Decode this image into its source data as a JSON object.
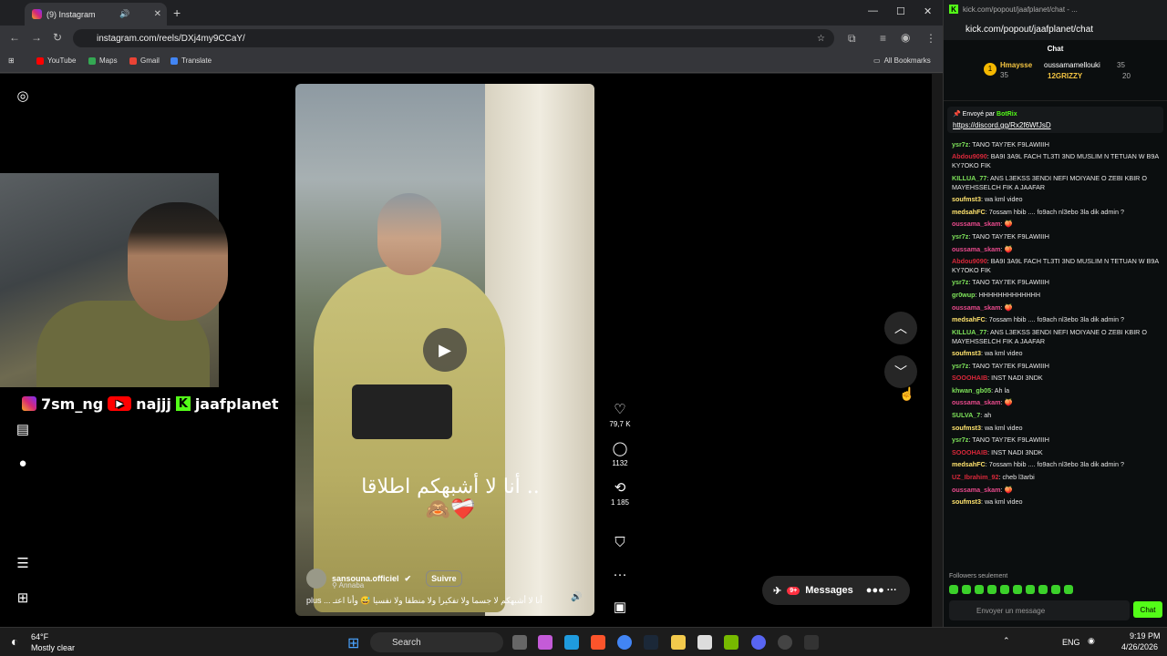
{
  "browser": {
    "tab_title": "(9) Instagram",
    "url": "instagram.com/reels/DXj4my9CCaY/",
    "bookmarks": [
      "YouTube",
      "Maps",
      "Gmail",
      "Translate"
    ],
    "all_bookmarks": "All Bookmarks"
  },
  "reel": {
    "username": "sansouna.officiel",
    "follow": "Suivre",
    "location": "Annaba",
    "overlay_text": "أنا لا أشبهكم اطلاقا ..🙈❤️‍🩹",
    "caption": "أنا لا أشبهكم لا جسما ولا تفكيرا ولا منطقا ولا نفسيا 😅 وأنا اعتـ",
    "more": "plus ...",
    "likes": "79,7 K",
    "comments": "1132",
    "shares": "1 185",
    "messages_label": "Messages",
    "messages_badge": "9+"
  },
  "stream_overlay": {
    "handle1": "7sm_ng",
    "handle2": "najjj",
    "handle3": "jaafplanet"
  },
  "chat": {
    "window_title": "kick.com/popout/jaafplanet/chat - ...",
    "url": "kick.com/popout/jaafplanet/chat",
    "header": "Chat",
    "gifters": [
      {
        "rank": "1",
        "name": "Hmaysse",
        "count": "35"
      },
      {
        "name": "oussamamellouki",
        "count": "35"
      },
      {
        "name": "12GRIZZY",
        "count": "20"
      }
    ],
    "pinned_by": "Envoyé par",
    "pinned_user": "BotRix",
    "pinned_link": "https://discord.gg/Rx2f6WfJsD",
    "messages": [
      {
        "user": "ysr7z",
        "color": "#7ee35a",
        "text": "TANO TAY7EK F9LAWIIIH"
      },
      {
        "user": "Abdou9090",
        "color": "#d9283a",
        "text": "BA9I 3A9L FACH TL3TI 3ND MUSLIM N TETUAN W B9A KY7OKO FIK"
      },
      {
        "user": "KILLUA_77",
        "color": "#7ee35a",
        "text": "ANS L3EKSS 3ENDI NEFI MOIYANE O ZEBI KBIR O MAYEHSSELCH FIK A JAAFAR"
      },
      {
        "user": "soufmst3",
        "color": "#ffe36e",
        "text": "wa kml video"
      },
      {
        "user": "medsahFC",
        "color": "#ffe36e",
        "text": "7ossam hbib .... fo9ach nl3ebo 3la dik admin ?"
      },
      {
        "user": "oussama_skam",
        "color": "#e84a8c",
        "text": "🍑"
      },
      {
        "user": "ysr7z",
        "color": "#7ee35a",
        "text": "TANO TAY7EK F9LAWIIIH"
      },
      {
        "user": "oussama_skam",
        "color": "#e84a8c",
        "text": "🍑"
      },
      {
        "user": "Abdou9090",
        "color": "#d9283a",
        "text": "BA9I 3A9L FACH TL3TI 3ND MUSLIM N TETUAN W B9A KY7OKO FIK"
      },
      {
        "user": "ysr7z",
        "color": "#7ee35a",
        "text": "TANO TAY7EK F9LAWIIIH"
      },
      {
        "user": "gr0wup",
        "color": "#7ee35a",
        "text": "HHHHHHHHHHHHH"
      },
      {
        "user": "oussama_skam",
        "color": "#e84a8c",
        "text": "🍑"
      },
      {
        "user": "medsahFC",
        "color": "#ffe36e",
        "text": "7ossam hbib .... fo9ach nl3ebo 3la dik admin ?"
      },
      {
        "user": "KILLUA_77",
        "color": "#7ee35a",
        "text": "ANS L3EKSS 3ENDI NEFI MOIYANE O ZEBI KBIR O MAYEHSSELCH FIK A JAAFAR"
      },
      {
        "user": "soufmst3",
        "color": "#ffe36e",
        "text": "wa kml video"
      },
      {
        "user": "ysr7z",
        "color": "#7ee35a",
        "text": "TANO TAY7EK F9LAWIIIH"
      },
      {
        "user": "SOOOHAIB",
        "color": "#d9283a",
        "text": "INST NADI 3NDK"
      },
      {
        "user": "khwan_gb05",
        "color": "#7ee35a",
        "text": "Ah la"
      },
      {
        "user": "oussama_skam",
        "color": "#e84a8c",
        "text": "🍑"
      },
      {
        "user": "SULVA_7",
        "color": "#7ee35a",
        "text": "ah"
      },
      {
        "user": "soufmst3",
        "color": "#ffe36e",
        "text": "wa kml video"
      },
      {
        "user": "ysr7z",
        "color": "#7ee35a",
        "text": "TANO TAY7EK F9LAWIIIH"
      },
      {
        "user": "SOOOHAIB",
        "color": "#d9283a",
        "text": "INST NADI 3NDK"
      },
      {
        "user": "medsahFC",
        "color": "#ffe36e",
        "text": "7ossam hbib .... fo9ach nl3ebo 3la dik admin ?"
      },
      {
        "user": "UZ_Ibrahim_92",
        "color": "#d9283a",
        "text": "cheb l3arbi"
      },
      {
        "user": "oussama_skam",
        "color": "#e84a8c",
        "text": "🍑"
      },
      {
        "user": "soufmst3",
        "color": "#ffe36e",
        "text": "wa kml video"
      }
    ],
    "followers_only": "Followers seulement",
    "input_placeholder": "Envoyer un message",
    "send": "Chat"
  },
  "taskbar": {
    "temp": "64°F",
    "weather": "Mostly clear",
    "search": "Search",
    "lang": "ENG",
    "time": "9:19 PM",
    "date": "4/26/2026"
  }
}
